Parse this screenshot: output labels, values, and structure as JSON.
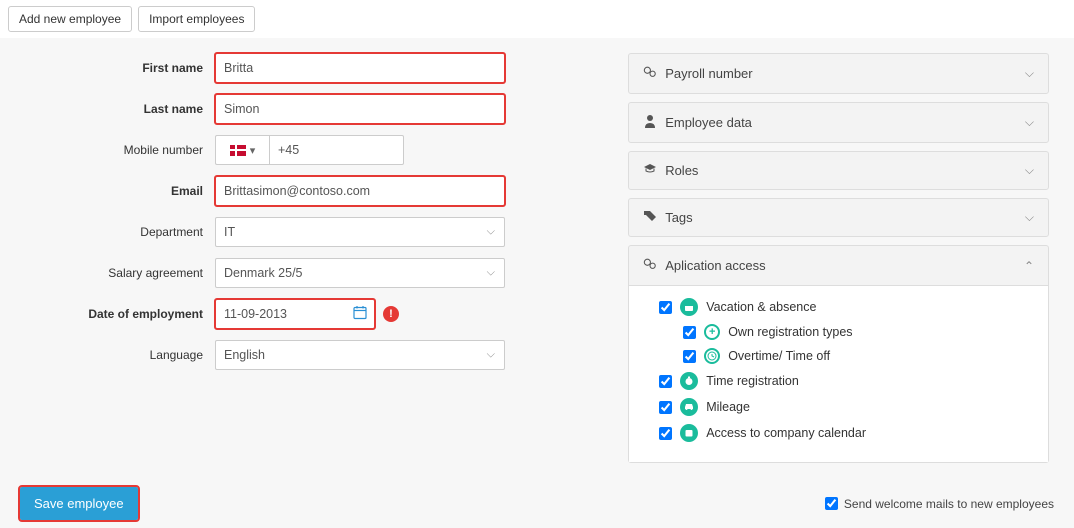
{
  "toolbar": {
    "add_label": "Add new employee",
    "import_label": "Import employees"
  },
  "form": {
    "first_name": {
      "label": "First name",
      "value": "Britta"
    },
    "last_name": {
      "label": "Last name",
      "value": "Simon"
    },
    "mobile": {
      "label": "Mobile number",
      "prefix": "+45"
    },
    "email": {
      "label": "Email",
      "value": "Brittasimon@contoso.com"
    },
    "department": {
      "label": "Department",
      "value": "IT"
    },
    "salary": {
      "label": "Salary agreement",
      "value": "Denmark 25/5"
    },
    "doe": {
      "label": "Date of employment",
      "value": "11-09-2013"
    },
    "language": {
      "label": "Language",
      "value": "English"
    }
  },
  "panels": {
    "payroll": "Payroll number",
    "empdata": "Employee data",
    "roles": "Roles",
    "tags": "Tags",
    "access": "Aplication access"
  },
  "access_items": {
    "vacation": "Vacation & absence",
    "own_reg": "Own registration types",
    "overtime": "Overtime/ Time off",
    "time_reg": "Time registration",
    "mileage": "Mileage",
    "calendar": "Access to company calendar"
  },
  "footer": {
    "save": "Save employee",
    "welcome_mail": "Send welcome mails to new employees"
  }
}
